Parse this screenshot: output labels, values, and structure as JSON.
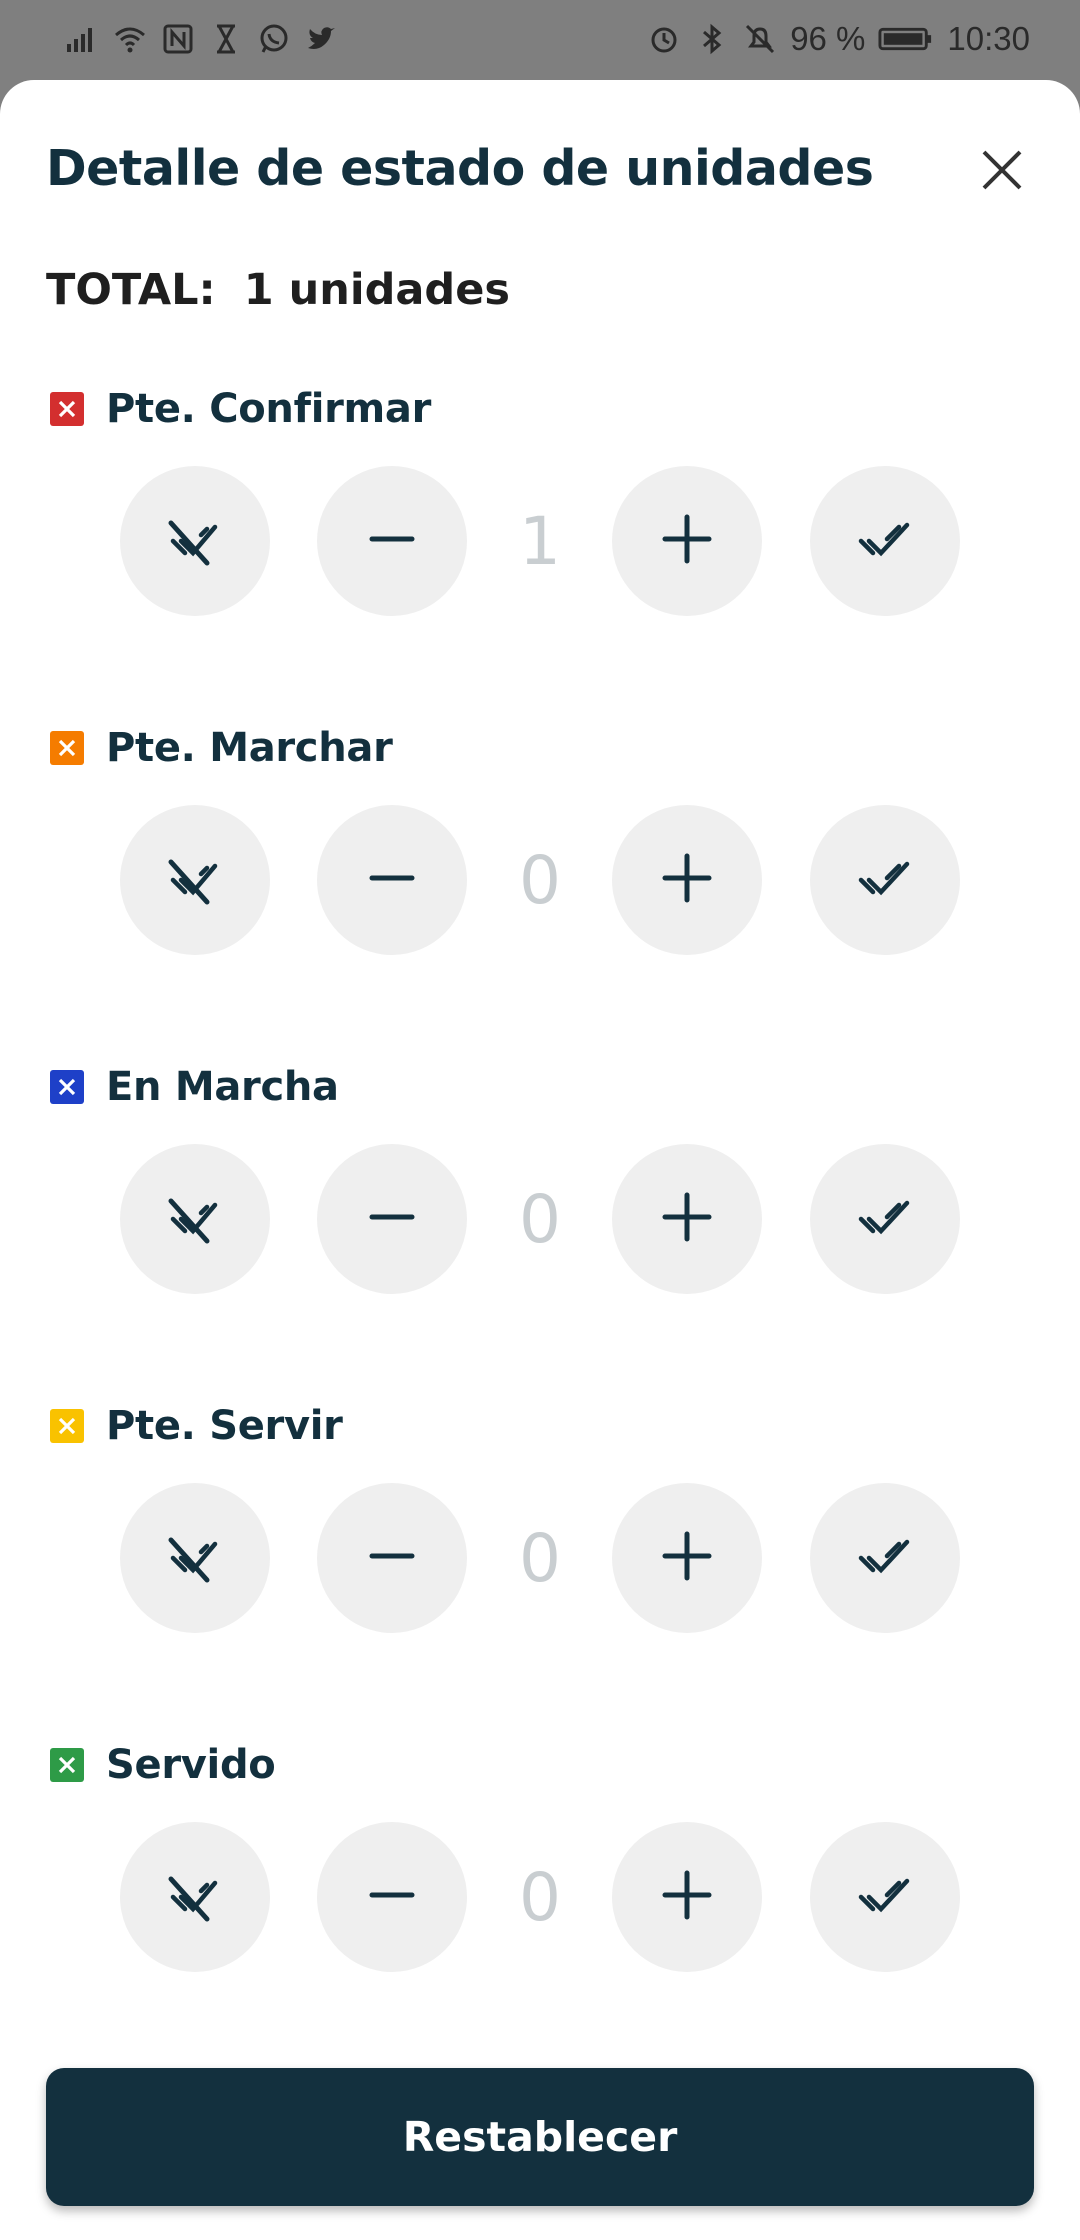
{
  "status_bar": {
    "left_icons": [
      "signal-icon",
      "wifi-icon",
      "nfc-icon",
      "hourglass-icon",
      "whatsapp-icon",
      "twitter-icon"
    ],
    "right_icons": [
      "alarm-icon",
      "bluetooth-icon",
      "bell-off-icon"
    ],
    "battery": "96 %",
    "time": "10:30"
  },
  "sheet": {
    "title": "Detalle de estado de unidades",
    "total_label": "TOTAL:",
    "total_value": "1 unidades",
    "sections": [
      {
        "label": "Pte. Confirmar",
        "count": "1",
        "color": "#d32f2f"
      },
      {
        "label": "Pte. Marchar",
        "count": "0",
        "color": "#f57c00"
      },
      {
        "label": "En Marcha",
        "count": "0",
        "color": "#1e40c8"
      },
      {
        "label": "Pte. Servir",
        "count": "0",
        "color": "#f9c200"
      },
      {
        "label": "Servido",
        "count": "0",
        "color": "#2e9b47"
      }
    ],
    "reset_label": "Restablecer"
  },
  "colors": {
    "primary": "#13303e",
    "button_bg": "#efefef",
    "count_text": "#c9ced1"
  }
}
